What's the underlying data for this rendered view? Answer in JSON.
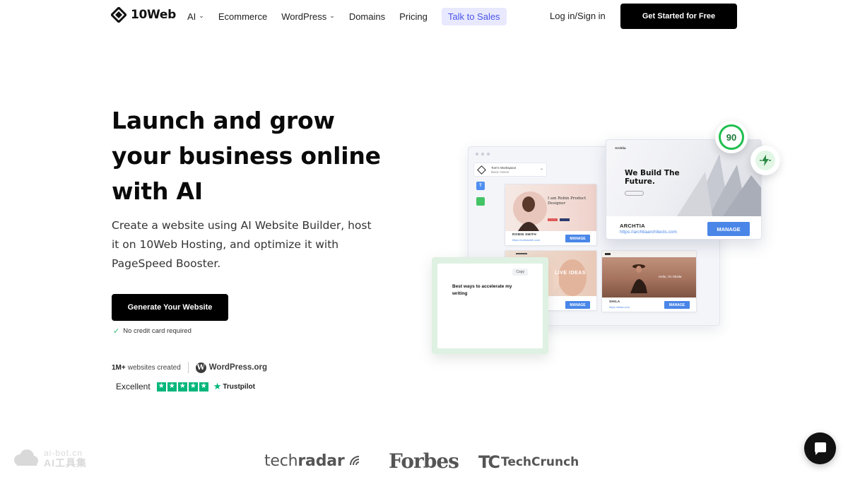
{
  "brand": {
    "name": "10Web"
  },
  "nav": {
    "links": [
      {
        "label": "AI",
        "has_dropdown": true
      },
      {
        "label": "Ecommerce",
        "has_dropdown": false
      },
      {
        "label": "WordPress",
        "has_dropdown": true
      },
      {
        "label": "Domains",
        "has_dropdown": false
      },
      {
        "label": "Pricing",
        "has_dropdown": false
      }
    ],
    "talk_to_sales": "Talk to Sales",
    "login": "Log in/Sign in",
    "get_started": "Get Started for Free"
  },
  "hero": {
    "title": "Launch and grow your business online with AI",
    "subtitle": "Create a website using AI Website Builder, host it on 10Web Hosting, and optimize it with PageSpeed Booster.",
    "cta": "Generate Your Website",
    "no_credit_card": "No credit card required",
    "stats_strong": "1M+",
    "stats_text": "websites created",
    "wordpress": "WordPress.org",
    "rating_label": "Excellent",
    "trustpilot": "Trustpilot"
  },
  "mockup": {
    "workspace_line1": "Tom's Workspace",
    "workspace_line2": "Basic Owner",
    "sidebar_initial": "T",
    "cards": [
      {
        "headline": "I am Robin Product Designer",
        "name": "ROBIN SMITH",
        "url": "https://robinsmith.com",
        "manage": "MANAGE"
      },
      {
        "headline": "LIVE IDEAS",
        "name": "",
        "url": "",
        "manage": "MANAGE"
      },
      {
        "headline": "Hello, I'm Sheila",
        "name": "SHILA",
        "url": "https://shila.com",
        "manage": "MANAGE"
      }
    ],
    "archtia": {
      "logo": "Archtia",
      "headline": "We Build The Future.",
      "name": "ARCHTIA",
      "url": "https://archtiaarchitects.com",
      "manage": "MANAGE"
    },
    "pagespeed_score": "90",
    "writing_copy": "Copy",
    "writing_text": "Best ways to accelerate my writing"
  },
  "press": {
    "techradar_light": "tech",
    "techradar_bold": "radar",
    "forbes": "Forbes",
    "techcrunch_mark": "TC",
    "techcrunch": "TechCrunch"
  },
  "watermark": {
    "line1": "ai-bot.cn",
    "line2": "AI工具集"
  },
  "icons": {
    "logo": "10web-diamond-icon",
    "chevron": "chevron-down-icon",
    "check": "check-icon",
    "wordpress": "wordpress-icon",
    "trustpilot": "trustpilot-star-icon",
    "chat": "chat-bubble-icon",
    "bolt": "lightning-bolt-icon"
  },
  "colors": {
    "accent_blue": "#4a86e8",
    "talk_bg": "#e8e9fe",
    "talk_text": "#4a55e8",
    "trustpilot_green": "#00b67a",
    "score_green": "#1fbf4f"
  }
}
